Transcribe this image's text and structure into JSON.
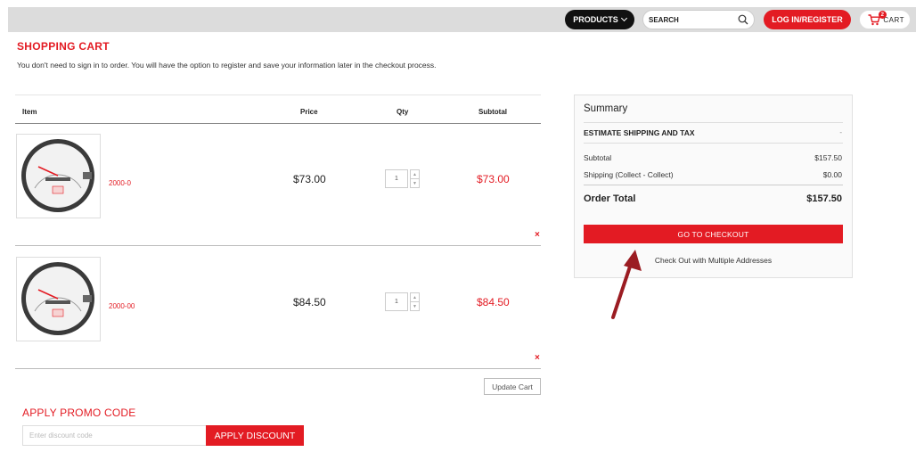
{
  "header": {
    "products_label": "PRODUCTS",
    "search_placeholder": "SEARCH",
    "login_label": "LOG IN/REGISTER",
    "cart_label": "CART",
    "cart_count": "2"
  },
  "page": {
    "title": "SHOPPING CART",
    "intro": "You don't need to sign in to order. You will have the option to register and save your information later in the checkout process."
  },
  "cart": {
    "columns": {
      "item": "Item",
      "price": "Price",
      "qty": "Qty",
      "subtotal": "Subtotal"
    },
    "items": [
      {
        "sku": "2000-0",
        "price": "$73.00",
        "qty": "1",
        "subtotal": "$73.00",
        "remove": "×"
      },
      {
        "sku": "2000-00",
        "price": "$84.50",
        "qty": "1",
        "subtotal": "$84.50",
        "remove": "×"
      }
    ],
    "update_label": "Update Cart"
  },
  "promo": {
    "title": "APPLY PROMO CODE",
    "placeholder": "Enter discount code",
    "button_label": "APPLY DISCOUNT"
  },
  "summary": {
    "title": "Summary",
    "estimate_label": "ESTIMATE SHIPPING AND TAX",
    "estimate_caret": "-",
    "subtotal_label": "Subtotal",
    "subtotal_value": "$157.50",
    "shipping_label": "Shipping (Collect - Collect)",
    "shipping_value": "$0.00",
    "total_label": "Order Total",
    "total_value": "$157.50",
    "checkout_label": "GO TO CHECKOUT",
    "multi_label": "Check Out with Multiple Addresses"
  },
  "colors": {
    "accent": "#e31b23",
    "arrow": "#9b1c22"
  },
  "icons": [
    "chevron-down-icon",
    "search-icon",
    "cart-icon",
    "remove-icon",
    "arrow-annotation"
  ]
}
